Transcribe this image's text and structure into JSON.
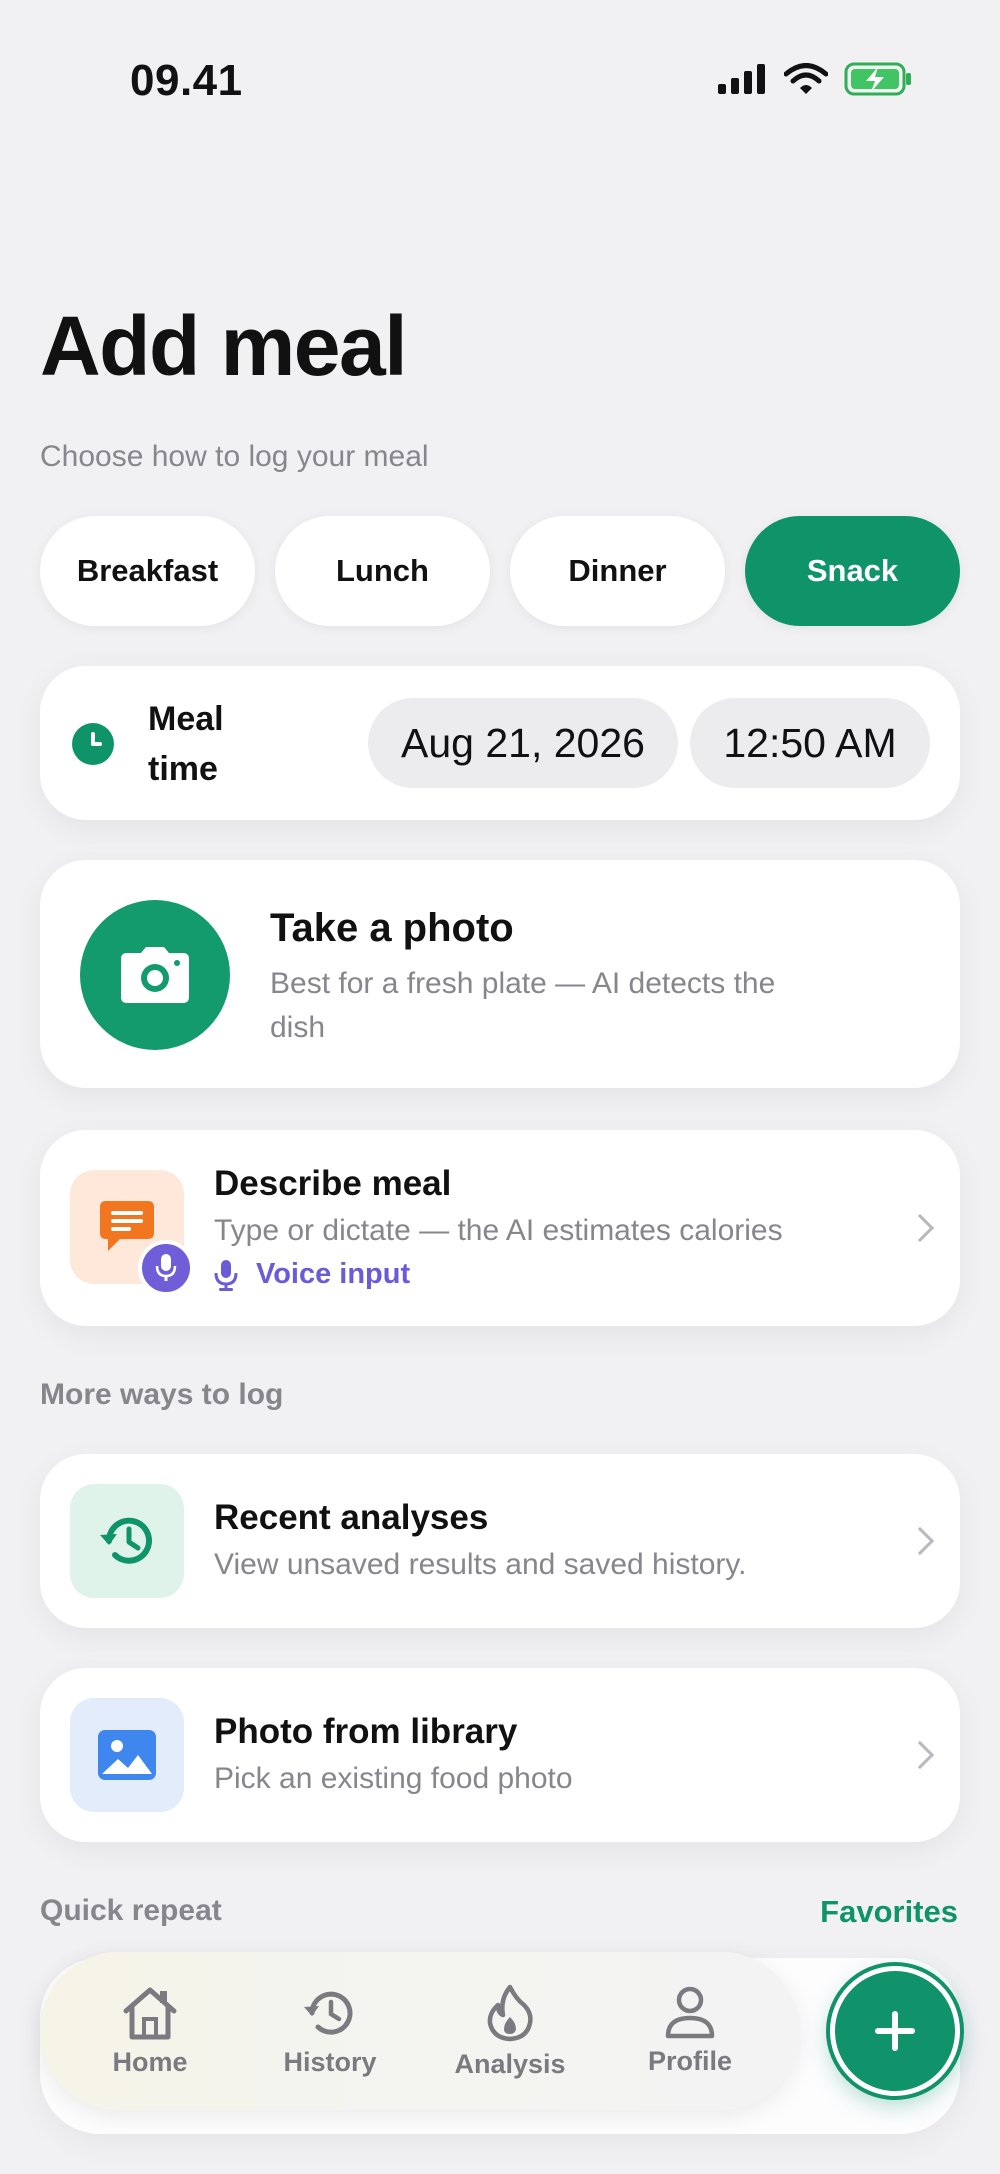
{
  "status_bar": {
    "time": "09.41"
  },
  "header": {
    "title": "Add meal",
    "subtitle": "Choose how to log your meal"
  },
  "meal_types": [
    {
      "label": "Breakfast",
      "selected": false
    },
    {
      "label": "Lunch",
      "selected": false
    },
    {
      "label": "Dinner",
      "selected": false
    },
    {
      "label": "Snack",
      "selected": true
    }
  ],
  "meal_time": {
    "label": "Meal time",
    "date": "Aug 21, 2026",
    "time": "12:50 AM"
  },
  "take_photo": {
    "title": "Take a photo",
    "description": "Best for a fresh plate — AI detects the dish"
  },
  "describe_meal": {
    "title": "Describe meal",
    "description": "Type or dictate — the AI estimates calories",
    "voice_label": "Voice input"
  },
  "more_ways": {
    "label": "More ways to log",
    "items": [
      {
        "title": "Recent analyses",
        "subtitle": "View unsaved results and saved history.",
        "icon": "history-icon"
      },
      {
        "title": "Photo from library",
        "subtitle": "Pick an existing food photo",
        "icon": "image-icon"
      }
    ]
  },
  "quick_repeat": {
    "label": "Quick repeat",
    "favorites_link": "Favorites"
  },
  "tab_bar": {
    "items": [
      {
        "label": "Home",
        "icon": "home-icon"
      },
      {
        "label": "History",
        "icon": "history-icon"
      },
      {
        "label": "Analysis",
        "icon": "flame-icon"
      },
      {
        "label": "Profile",
        "icon": "person-icon"
      }
    ],
    "fab_icon": "plus-icon"
  },
  "colors": {
    "accent": "#0f9469",
    "voice_accent": "#6a5bd6",
    "orange": "#f2761f",
    "blue": "#3f87ee"
  }
}
